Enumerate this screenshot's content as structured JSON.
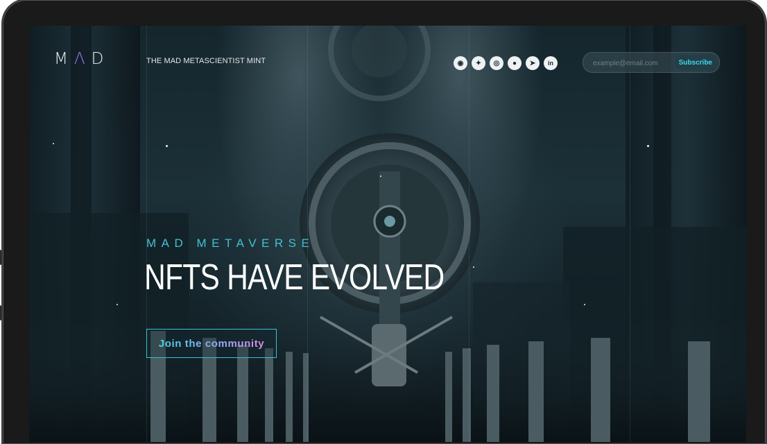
{
  "header": {
    "logo": {
      "part1": "M",
      "part2": "Λ",
      "part3": "D"
    },
    "subtitle": "THE MAD METASCIENTIST MINT",
    "socials": [
      {
        "icon": "discord-icon",
        "glyph": "◉"
      },
      {
        "icon": "twitter-icon",
        "glyph": "✦"
      },
      {
        "icon": "instagram-icon",
        "glyph": "◎"
      },
      {
        "icon": "medium-icon",
        "glyph": "●"
      },
      {
        "icon": "telegram-icon",
        "glyph": "➤"
      },
      {
        "icon": "linkedin-icon",
        "glyph": "in"
      }
    ],
    "email_placeholder": "example@email.com",
    "subscribe_label": "Subscribe"
  },
  "hero": {
    "eyebrow": "MAD METAVERSE",
    "headline": "NFTS HAVE EVOLVED",
    "cta_label": "Join the community"
  },
  "colors": {
    "accent_cyan": "#41c2d2",
    "logo_accent": "#8f7bff",
    "subscribe_text": "#42d6e6",
    "background": "#15262d"
  }
}
